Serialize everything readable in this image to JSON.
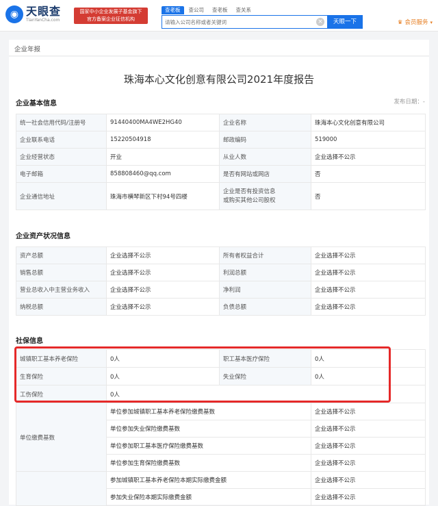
{
  "header": {
    "logo_cn": "天眼查",
    "logo_en": "TianYanCha.com",
    "slogan_line1": "国家中小企业发展子基金旗下",
    "slogan_line2": "官方备案企业征信机构",
    "search_tabs": [
      "查老板",
      "查公司",
      "查老板",
      "查关系"
    ],
    "search_placeholder": "请输入公司名称或者关键词",
    "search_button": "天眼一下",
    "member": "会员服务",
    "clear_symbol": "×",
    "crown_symbol": "♛",
    "caret_symbol": "▾"
  },
  "page": {
    "breadcrumb": "企业年报",
    "report_title": "珠海本心文化创意有限公司2021年度报告",
    "publish_date": "发布日期：-"
  },
  "basic": {
    "title": "企业基本信息",
    "rows": [
      [
        "统一社会信用代码/注册号",
        "91440400MA4WE2HG40",
        "企业名称",
        "珠海本心文化创意有限公司"
      ],
      [
        "企业联系电话",
        "15220504918",
        "邮政编码",
        "519000"
      ],
      [
        "企业经营状态",
        "开业",
        "从业人数",
        "企业选择不公示"
      ],
      [
        "电子邮箱",
        "858808460@qq.com",
        "是否有网站或网店",
        "否"
      ],
      [
        "企业通信地址",
        "珠海市横琴新区下村94号四楼",
        "企业是否有投资信息\n或购买其他公司股权",
        "否"
      ]
    ]
  },
  "assets": {
    "title": "企业资产状况信息",
    "rows": [
      [
        "资产总额",
        "企业选择不公示",
        "所有者权益合计",
        "企业选择不公示"
      ],
      [
        "销售总额",
        "企业选择不公示",
        "利润总额",
        "企业选择不公示"
      ],
      [
        "营业总收入中主营业务收入",
        "企业选择不公示",
        "净利润",
        "企业选择不公示"
      ],
      [
        "纳税总额",
        "企业选择不公示",
        "负债总额",
        "企业选择不公示"
      ]
    ]
  },
  "social": {
    "title": "社保信息",
    "rows": [
      [
        "城镇职工基本养老保险",
        "0人",
        "职工基本医疗保险",
        "0人"
      ],
      [
        "生育保险",
        "0人",
        "失业保险",
        "0人"
      ],
      [
        "工伤保险",
        "0人",
        "",
        ""
      ]
    ],
    "fee_label": "单位缴费基数",
    "fee_rows": [
      [
        "单位参加城镇职工基本养老保险缴费基数",
        "企业选择不公示"
      ],
      [
        "单位参加失业保险缴费基数",
        "企业选择不公示"
      ],
      [
        "单位参加职工基本医疗保险缴费基数",
        "企业选择不公示"
      ],
      [
        "单位参加生育保险缴费基数",
        "企业选择不公示"
      ]
    ],
    "actual_rows": [
      [
        "参加城镇职工基本养老保险本期实际缴费金额",
        "企业选择不公示"
      ],
      [
        "参加失业保险本期实际缴费金额",
        "企业选择不公示"
      ]
    ]
  }
}
